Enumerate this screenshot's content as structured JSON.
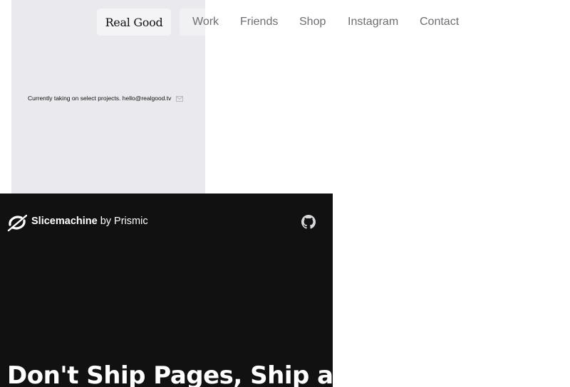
{
  "realgood": {
    "logo": "Real Good",
    "nav": [
      {
        "label": "Work"
      },
      {
        "label": "Friends"
      },
      {
        "label": "Shop"
      },
      {
        "label": "Instagram"
      },
      {
        "label": "Contact"
      }
    ],
    "contact_text": "Currently taking on select projects. hello@realgood.tv",
    "panel_color": "#e9e9ee",
    "nav_color": "#6e6e73"
  },
  "slicemachine": {
    "brand_bold": "Slicemachine",
    "brand_rest": " by Prismic",
    "hero": "Don't Ship Pages, Ship a",
    "background": "#121112",
    "icons": [
      "slicemachine-logo-icon",
      "github-icon"
    ]
  }
}
